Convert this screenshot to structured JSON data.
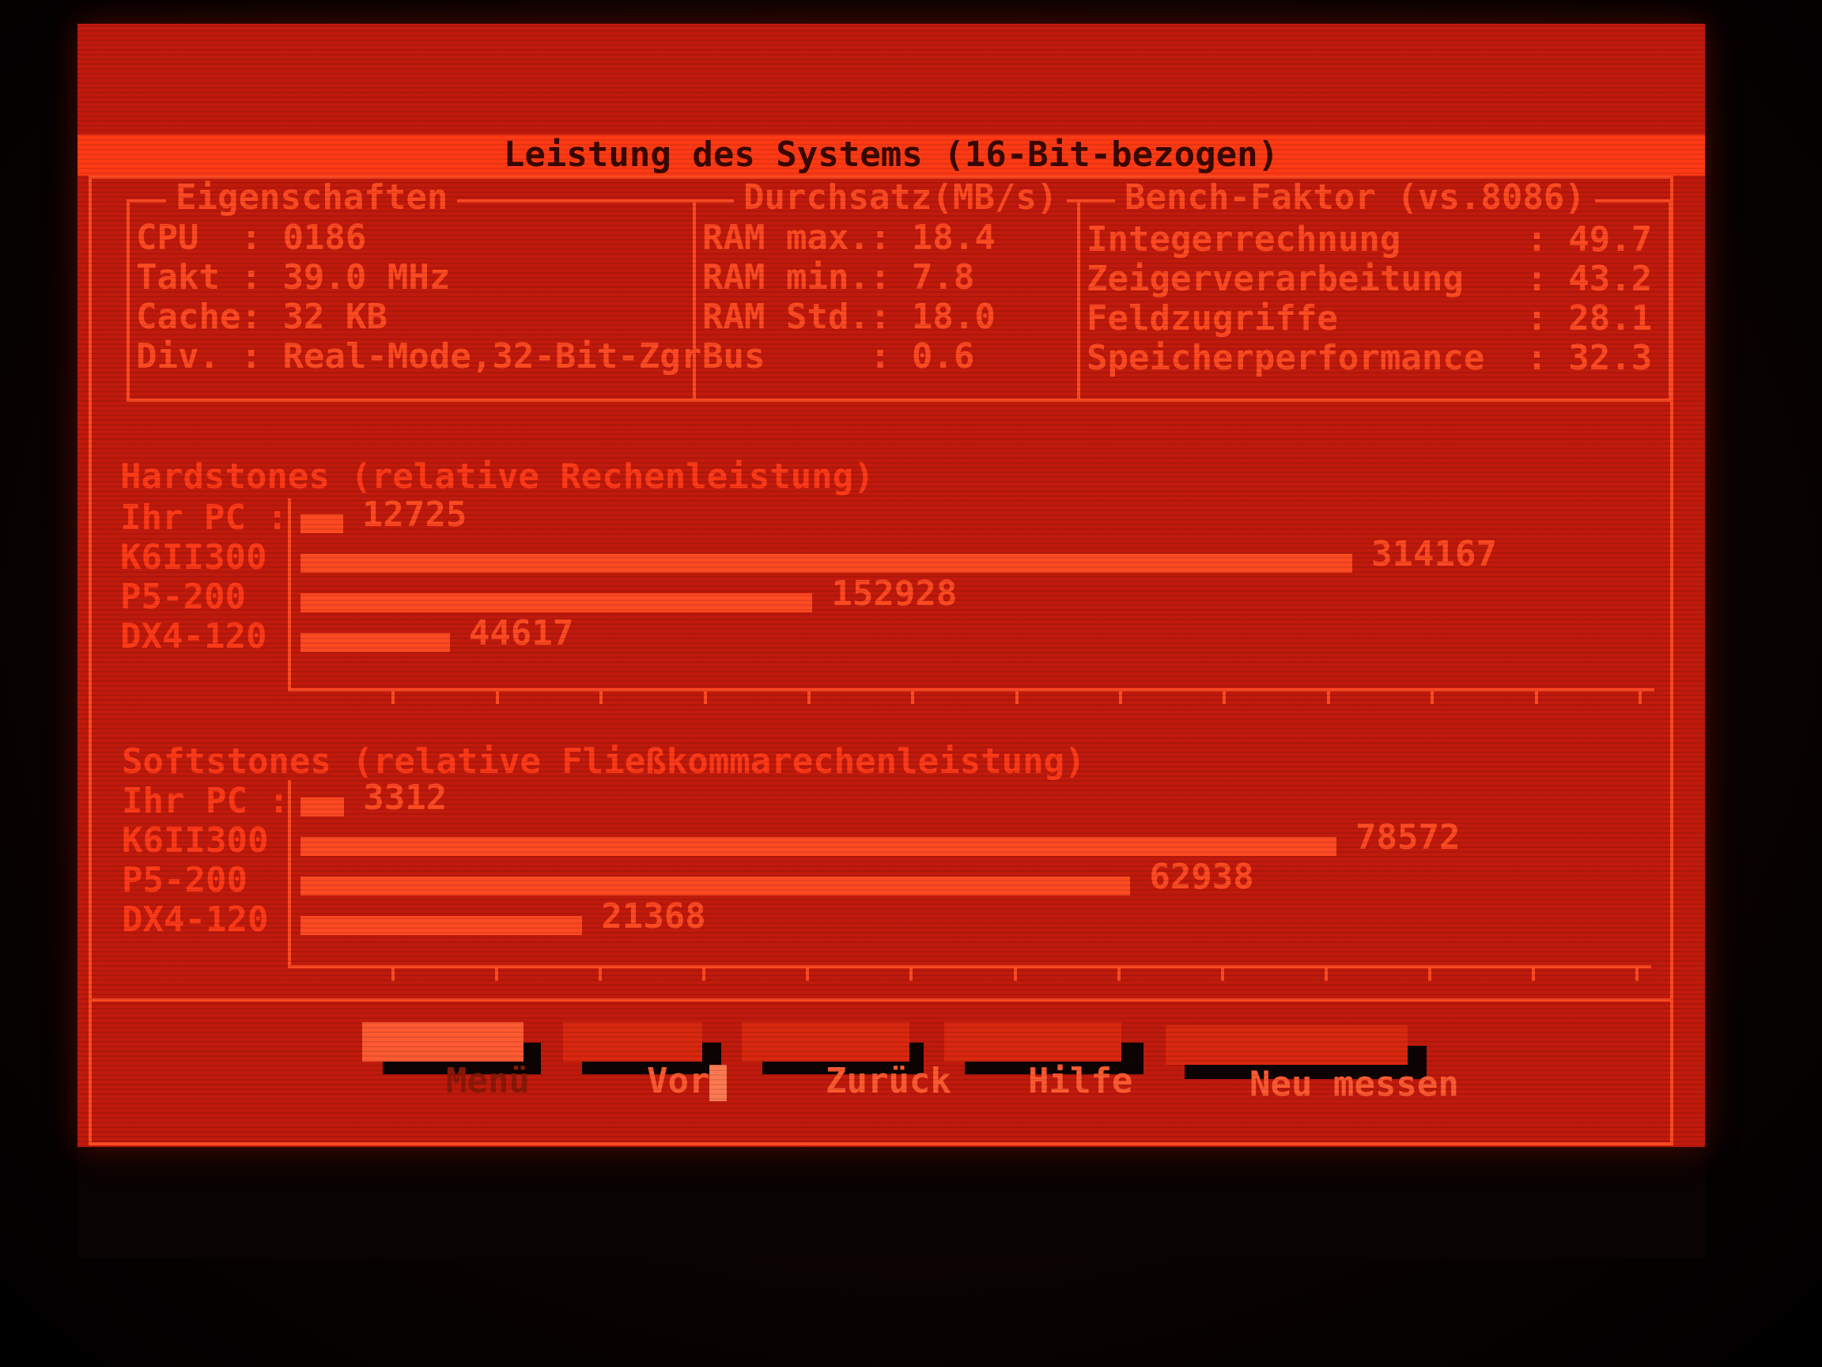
{
  "window": {
    "title": "Leistung des Systems (16-Bit-bezogen)"
  },
  "properties": {
    "title": "Eigenschaften",
    "rows": [
      {
        "key": "CPU  ",
        "value": "0186"
      },
      {
        "key": "Takt ",
        "value": "39.0 MHz"
      },
      {
        "key": "Cache",
        "value": "32 KB"
      },
      {
        "key": "Div. ",
        "value": "Real-Mode,32-Bit-Zgr"
      }
    ]
  },
  "throughput": {
    "title": "Durchsatz(MB/s)",
    "rows": [
      {
        "key": "RAM max.",
        "value": "18.4"
      },
      {
        "key": "RAM min.",
        "value": "7.8"
      },
      {
        "key": "RAM Std.",
        "value": "18.0"
      },
      {
        "key": "Bus     ",
        "value": "0.6"
      }
    ]
  },
  "bench": {
    "title": "Bench-Faktor (vs.8086)",
    "rows": [
      {
        "key": "Integerrechnung      ",
        "value": "49.7"
      },
      {
        "key": "Zeigerverarbeitung   ",
        "value": "43.2"
      },
      {
        "key": "Feldzugriffe         ",
        "value": "28.1"
      },
      {
        "key": "Speicherperformance  ",
        "value": "32.3"
      }
    ]
  },
  "chart_data": [
    {
      "type": "bar",
      "title": "Hardstones (relative Rechenleistung)",
      "categories": [
        "Ihr PC :",
        "K6II300",
        "P5-200",
        "DX4-120"
      ],
      "values": [
        12725,
        314167,
        152928,
        44617
      ],
      "labels": [
        "12725",
        "314167",
        "152928",
        "44617"
      ],
      "grid": false,
      "ticks": 13
    },
    {
      "type": "bar",
      "title": "Softstones (relative Fließkommarechenleistung)",
      "categories": [
        "Ihr PC :",
        "K6II300",
        "P5-200",
        "DX4-120"
      ],
      "values": [
        3312,
        78572,
        62938,
        21368
      ],
      "labels": [
        "3312",
        "78572",
        "62938",
        "21368"
      ],
      "grid": false,
      "ticks": 13
    }
  ],
  "buttons": {
    "menu": "Menü",
    "forward": "Vor",
    "back": "Zurück",
    "help": "Hilfe",
    "remeasure": "Neu messen"
  },
  "colors": {
    "screen": "#c01a0c",
    "foreground": "#ff4a22",
    "titlebar": "#ff3a14"
  }
}
